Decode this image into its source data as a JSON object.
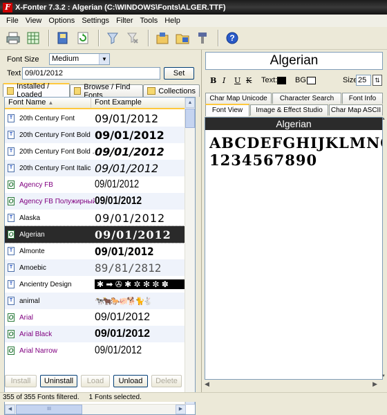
{
  "window": {
    "title": "X-Fonter 7.3.2  :  Algerian (C:\\WINDOWS\\Fonts\\ALGER.TTF)"
  },
  "menu": [
    "File",
    "View",
    "Options",
    "Settings",
    "Filter",
    "Tools",
    "Help"
  ],
  "toolbar": {
    "icons": [
      "printer-icon",
      "grid-icon",
      "book-icon",
      "refresh-icon",
      "filter-icon",
      "clear-filter-icon",
      "install-icon",
      "folder-icon",
      "uninstall-icon",
      "help-icon"
    ]
  },
  "controls": {
    "font_size_label": "Font Size",
    "font_size_value": "Medium",
    "text_label": "Text",
    "text_value": "09/01/2012",
    "set_label": "Set"
  },
  "tabs": [
    "Installed / Loaded",
    "Browse / Find Fonts",
    "Collections"
  ],
  "list": {
    "col_name": "Font Name",
    "col_example": "Font Example",
    "rows": [
      {
        "name": "20th Century Font",
        "example": "09/01/2012"
      },
      {
        "name": "20th Century Font Bold",
        "example": "09/01/2012"
      },
      {
        "name": "20th Century Font Bold ...",
        "example": "09/01/2012"
      },
      {
        "name": "20th Century Font Italic",
        "example": "09/01/2012"
      },
      {
        "name": "Agency FB",
        "example": "09/01/2012"
      },
      {
        "name": "Agency FB Полужирный",
        "example": "09/01/2012"
      },
      {
        "name": "Alaska",
        "example": "09/01/2012"
      },
      {
        "name": "Algerian",
        "example": "09/01/2012"
      },
      {
        "name": "Almonte",
        "example": "09/01/2012"
      },
      {
        "name": "Amoebic",
        "example": "89/81/2812"
      },
      {
        "name": "Ancientry  Design",
        "example": "✱ ➡ ✇ ✱ ✲ ✻ ✼ ✽"
      },
      {
        "name": "animal",
        "example": "🐄🐂🐎🐖🐕🐈🐇"
      },
      {
        "name": "Arial",
        "example": "09/01/2012"
      },
      {
        "name": "Arial Black",
        "example": "09/01/2012"
      },
      {
        "name": "Arial Narrow",
        "example": "09/01/2012"
      }
    ]
  },
  "bottom_buttons": {
    "install": "Install",
    "uninstall": "Uninstall",
    "load": "Load",
    "unload": "Unload",
    "delete": "Delete"
  },
  "status": {
    "filtered": "355 of 355 Fonts filtered.",
    "selected": "1 Fonts selected."
  },
  "right": {
    "font_name": "Algerian",
    "fmt_bold": "B",
    "fmt_italic": "I",
    "fmt_underline": "U",
    "fmt_strike": "K",
    "text_color_label": "Text:",
    "bg_label": "BG:",
    "size_label": "Size",
    "size_value": "25",
    "tabs_row1": [
      "Char Map Unicode",
      "Character Search",
      "Font Info"
    ],
    "tabs_row2": [
      "Font View",
      "Image & Effect Studio",
      "Char Map ASCII"
    ],
    "preview_header": "Algerian",
    "preview_line1": "ABCDEFGHIJKLMNOP",
    "preview_line2": "1234567890"
  },
  "colors": {
    "title_bg": "#1c1c1c",
    "selected_row": "#316ac5",
    "purple_text": "#800080",
    "tab_accent": "#ffc83c"
  }
}
